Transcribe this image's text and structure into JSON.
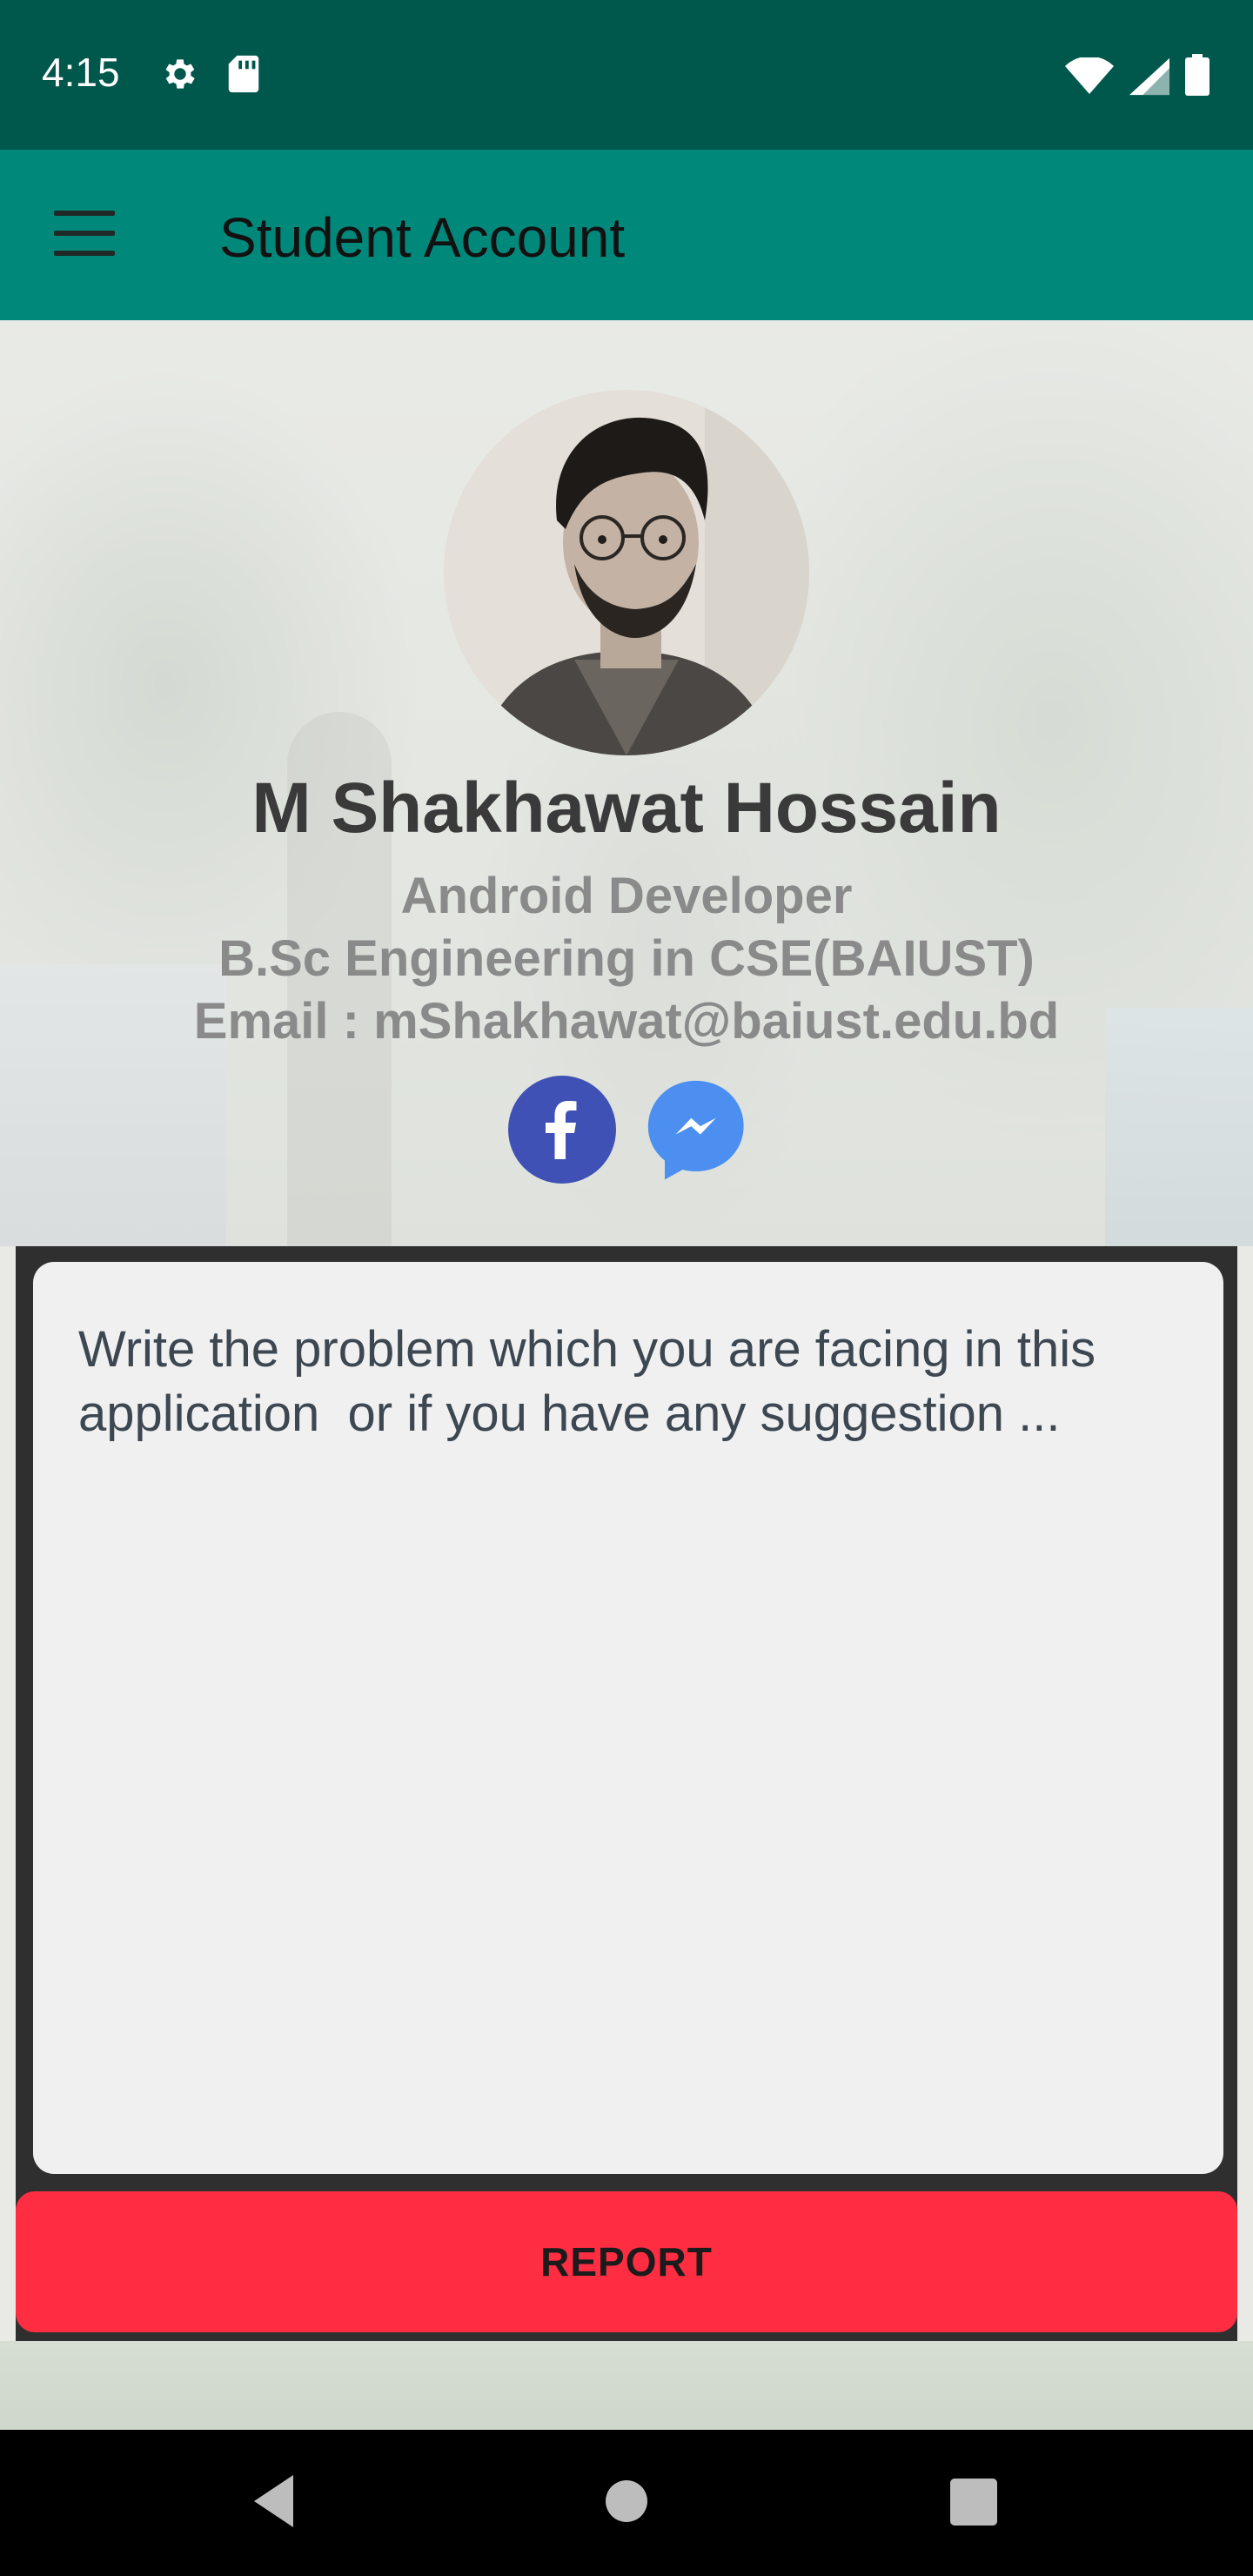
{
  "status_bar": {
    "time": "4:15",
    "icons": [
      "gear-icon",
      "sd-card-icon",
      "wifi-icon",
      "signal-icon",
      "battery-icon"
    ]
  },
  "app_bar": {
    "title": "Student Account",
    "menu_icon": "hamburger-menu-icon",
    "color": "#00887a",
    "status_color": "#00574b"
  },
  "profile": {
    "name": "M Shakhawat Hossain",
    "role": "Android Developer",
    "degree": "B.Sc Engineering in CSE(BAIUST)",
    "email": "Email : mShakhawat@baiust.edu.bd",
    "social": [
      "facebook-icon",
      "messenger-icon"
    ]
  },
  "report": {
    "placeholder": "Write the problem which you are facing in this application  or if you have any suggestion ...",
    "button_label": "REPORT",
    "button_color": "#ff2d42"
  },
  "nav_bar": {
    "buttons": [
      "back-icon",
      "home-icon",
      "recent-apps-icon"
    ]
  }
}
